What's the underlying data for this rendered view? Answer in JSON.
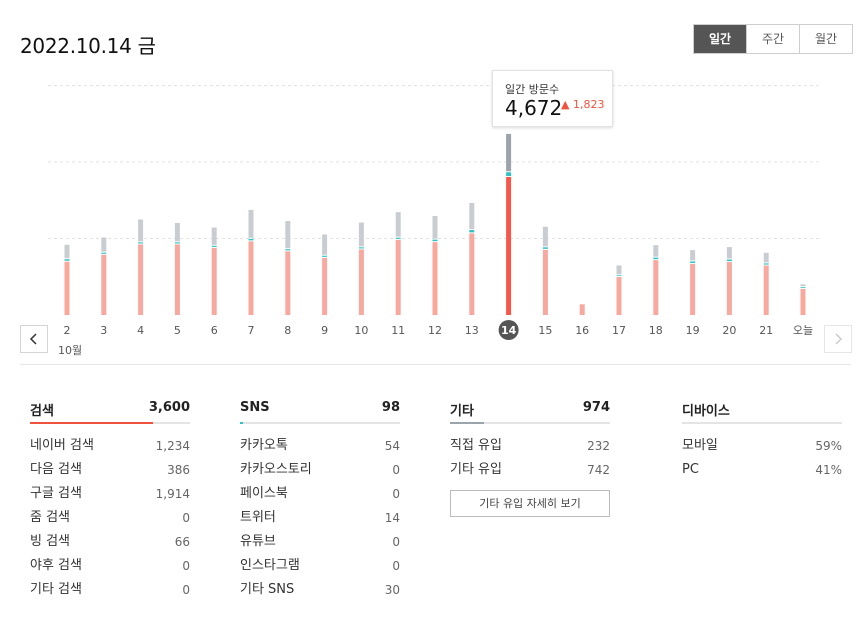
{
  "header": {
    "date_title": "2022.10.14 금",
    "tabs": [
      {
        "label": "일간",
        "active": true
      },
      {
        "label": "주간",
        "active": false
      },
      {
        "label": "월간",
        "active": false
      }
    ]
  },
  "tooltip": {
    "title": "일간 방문수",
    "value": "4,672",
    "delta": "▲ 1,823"
  },
  "month_label": "10월",
  "chart_data": {
    "type": "bar",
    "stacked": true,
    "categories": [
      "2",
      "3",
      "4",
      "5",
      "6",
      "7",
      "8",
      "9",
      "10",
      "11",
      "12",
      "13",
      "14",
      "15",
      "16",
      "17",
      "18",
      "19",
      "20",
      "21",
      "오늘"
    ],
    "selected_index": 12,
    "series": [
      {
        "values": [
          1390,
          1570,
          1840,
          1840,
          1750,
          1920,
          1660,
          1490,
          1710,
          1960,
          1900,
          2130,
          3600,
          1700,
          280,
          990,
          1430,
          1330,
          1380,
          1290,
          680
        ]
      },
      {
        "values": [
          40,
          30,
          30,
          30,
          30,
          40,
          30,
          30,
          30,
          30,
          40,
          60,
          98,
          40,
          0,
          20,
          40,
          40,
          40,
          30,
          20
        ]
      },
      {
        "values": [
          350,
          370,
          570,
          480,
          450,
          730,
          710,
          530,
          620,
          640,
          590,
          680,
          974,
          510,
          0,
          230,
          300,
          270,
          300,
          250,
          50
        ]
      }
    ],
    "colors": {
      "search": "#f7a89f",
      "search_selected": "#f5574a",
      "sns": "#2ec4c4",
      "other": "#c9cdd1",
      "other_selected": "#9ba3ab"
    },
    "ylim": [
      0,
      6000
    ],
    "grid": true
  },
  "stats": {
    "search": {
      "title": "검색",
      "total": "3,600",
      "share": 0.77,
      "color": "#f0523d",
      "rows": [
        {
          "label": "네이버 검색",
          "value": "1,234"
        },
        {
          "label": "다음 검색",
          "value": "386"
        },
        {
          "label": "구글 검색",
          "value": "1,914"
        },
        {
          "label": "줌 검색",
          "value": "0"
        },
        {
          "label": "빙 검색",
          "value": "66"
        },
        {
          "label": "야후 검색",
          "value": "0"
        },
        {
          "label": "기타 검색",
          "value": "0"
        }
      ]
    },
    "sns": {
      "title": "SNS",
      "total": "98",
      "share": 0.02,
      "color": "#2ec4c4",
      "rows": [
        {
          "label": "카카오톡",
          "value": "54"
        },
        {
          "label": "카카오스토리",
          "value": "0"
        },
        {
          "label": "페이스북",
          "value": "0"
        },
        {
          "label": "트위터",
          "value": "14"
        },
        {
          "label": "유튜브",
          "value": "0"
        },
        {
          "label": "인스타그램",
          "value": "0"
        },
        {
          "label": "기타 SNS",
          "value": "30"
        }
      ]
    },
    "other": {
      "title": "기타",
      "total": "974",
      "share": 0.21,
      "color": "#9ba3ab",
      "rows": [
        {
          "label": "직접 유입",
          "value": "232"
        },
        {
          "label": "기타 유입",
          "value": "742"
        }
      ],
      "detail_button": "기타 유입 자세히 보기"
    },
    "device": {
      "title": "디바이스",
      "rows": [
        {
          "label": "모바일",
          "value": "59%"
        },
        {
          "label": "PC",
          "value": "41%"
        }
      ]
    }
  }
}
